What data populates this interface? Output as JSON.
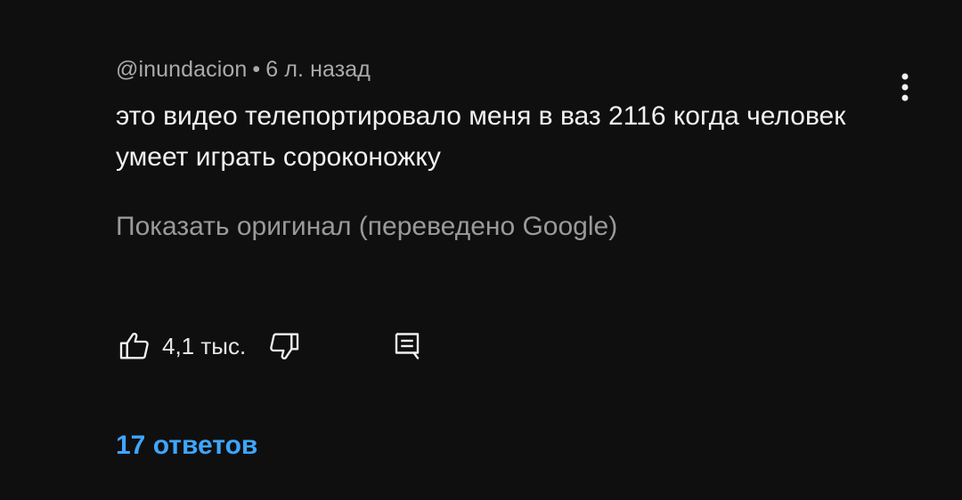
{
  "comment": {
    "author": "@inundacion",
    "separator": "•",
    "timestamp": "6 л. назад",
    "text": "это видео телепортировало меня в ваз 2116 когда человек умеет играть сороконожку",
    "translate_toggle": "Показать оригинал (переведено Google)",
    "like_count": "4,1 тыс.",
    "replies_label": "17 ответов"
  },
  "icons": {
    "menu": "more-vertical-icon",
    "like": "thumb-up-icon",
    "dislike": "thumb-down-icon",
    "reply": "comment-icon"
  },
  "colors": {
    "background": "#0f0f0f",
    "accent": "#3ea6ff",
    "text": "#f1f1f1",
    "secondary_text": "#aaaaaa"
  }
}
